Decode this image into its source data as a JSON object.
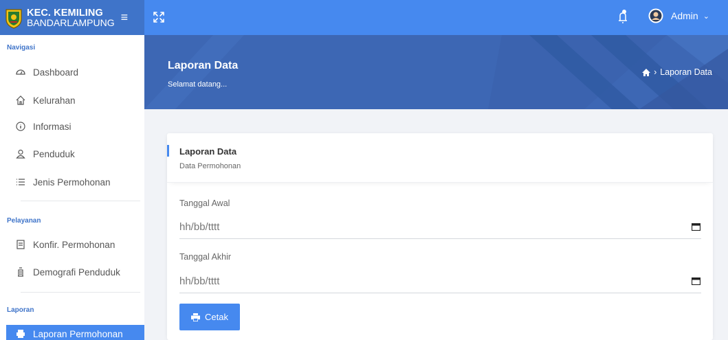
{
  "brand": {
    "line1": "KEC. KEMILING",
    "line2": "BANDARLAMPUNG"
  },
  "navbar": {
    "user_name": "Admin"
  },
  "sidebar": {
    "sections": [
      {
        "title": "Navigasi",
        "items": [
          {
            "label": "Dashboard",
            "icon": "dashboard-icon"
          },
          {
            "label": "Kelurahan",
            "icon": "home-icon"
          },
          {
            "label": "Informasi",
            "icon": "info-icon"
          },
          {
            "label": "Penduduk",
            "icon": "user-icon"
          },
          {
            "label": "Jenis Permohonan",
            "icon": "list-icon"
          }
        ]
      },
      {
        "title": "Pelayanan",
        "items": [
          {
            "label": "Konfir. Permohonan",
            "icon": "document-icon"
          },
          {
            "label": "Demografi Penduduk",
            "icon": "chart-icon"
          }
        ]
      },
      {
        "title": "Laporan",
        "items": [
          {
            "label": "Laporan Permohonan",
            "icon": "printer-icon",
            "active": true
          }
        ]
      }
    ]
  },
  "header": {
    "title": "Laporan Data",
    "subtitle": "Selamat datang...",
    "breadcrumb_current": "Laporan Data"
  },
  "card": {
    "title": "Laporan Data",
    "subtitle": "Data Permohonan",
    "start_label": "Tanggal Awal",
    "start_placeholder": "hh/bb/tttt",
    "end_label": "Tanggal Akhir",
    "end_placeholder": "hh/bb/tttt",
    "print_label": "Cetak"
  },
  "colors": {
    "brand": "#3f74c9",
    "primary": "#4689ef",
    "banner": "#3d67b4"
  }
}
